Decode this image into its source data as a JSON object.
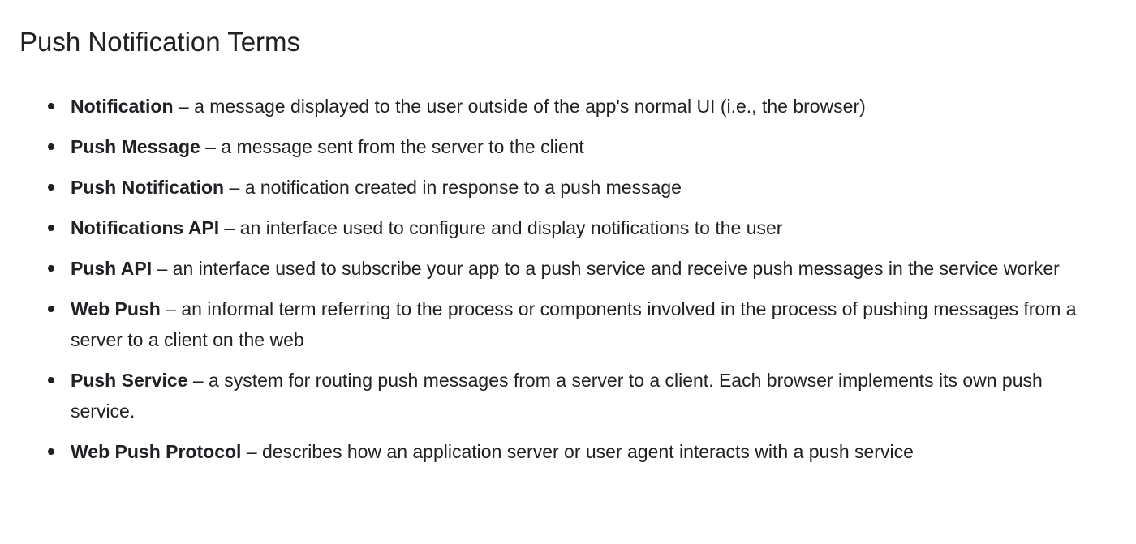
{
  "page": {
    "title": "Push Notification Terms"
  },
  "terms": [
    {
      "name": "Notification",
      "definition": " – a message displayed to the user outside of the app's normal UI (i.e., the browser)"
    },
    {
      "name": "Push Message",
      "definition": " – a message sent from the server to the client"
    },
    {
      "name": "Push Notification",
      "definition": " – a notification created in response to a push message"
    },
    {
      "name": "Notifications API",
      "definition": " – an interface used to configure and display notifications to the user"
    },
    {
      "name": "Push API",
      "definition": " – an interface used to subscribe your app to a push service and receive push messages in the service worker"
    },
    {
      "name": "Web Push",
      "definition": " – an informal term referring to the process or components involved in the process of pushing messages from a server to a client on the web"
    },
    {
      "name": "Push Service",
      "definition": " – a system for routing push messages from a server to a client. Each browser implements its own push service."
    },
    {
      "name": "Web Push Protocol",
      "definition": " – describes how an application server or user agent interacts with a push service"
    }
  ]
}
